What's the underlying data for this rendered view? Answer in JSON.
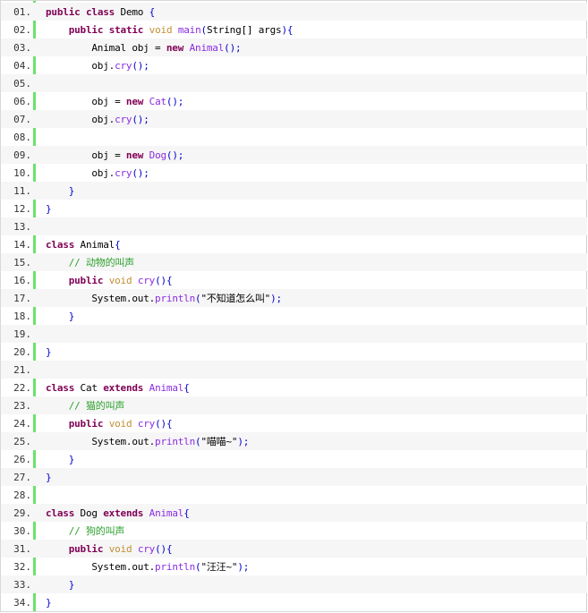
{
  "code_view": {
    "lines": [
      {
        "n": "01.",
        "tokens": [
          [
            "kw",
            "public"
          ],
          [
            "var",
            " "
          ],
          [
            "kw",
            "class"
          ],
          [
            "var",
            " Demo "
          ],
          [
            "punct",
            "{"
          ]
        ]
      },
      {
        "n": "02.",
        "tokens": [
          [
            "var",
            "    "
          ],
          [
            "kw",
            "public"
          ],
          [
            "var",
            " "
          ],
          [
            "kw",
            "static"
          ],
          [
            "var",
            " "
          ],
          [
            "type",
            "void"
          ],
          [
            "var",
            " "
          ],
          [
            "method",
            "main"
          ],
          [
            "punct",
            "("
          ],
          [
            "var",
            "String[] args"
          ],
          [
            "punct",
            ")"
          ],
          [
            "punct",
            "{"
          ]
        ]
      },
      {
        "n": "03.",
        "tokens": [
          [
            "var",
            "        Animal obj = "
          ],
          [
            "kw",
            "new"
          ],
          [
            "var",
            " "
          ],
          [
            "cls",
            "Animal"
          ],
          [
            "punct",
            "()"
          ],
          [
            "punct",
            ";"
          ]
        ]
      },
      {
        "n": "04.",
        "tokens": [
          [
            "var",
            "        obj."
          ],
          [
            "method",
            "cry"
          ],
          [
            "punct",
            "()"
          ],
          [
            "punct",
            ";"
          ]
        ]
      },
      {
        "n": "05.",
        "tokens": []
      },
      {
        "n": "06.",
        "tokens": [
          [
            "var",
            "        obj = "
          ],
          [
            "kw",
            "new"
          ],
          [
            "var",
            " "
          ],
          [
            "cls",
            "Cat"
          ],
          [
            "punct",
            "()"
          ],
          [
            "punct",
            ";"
          ]
        ]
      },
      {
        "n": "07.",
        "tokens": [
          [
            "var",
            "        obj."
          ],
          [
            "method",
            "cry"
          ],
          [
            "punct",
            "()"
          ],
          [
            "punct",
            ";"
          ]
        ]
      },
      {
        "n": "08.",
        "tokens": []
      },
      {
        "n": "09.",
        "tokens": [
          [
            "var",
            "        obj = "
          ],
          [
            "kw",
            "new"
          ],
          [
            "var",
            " "
          ],
          [
            "cls",
            "Dog"
          ],
          [
            "punct",
            "()"
          ],
          [
            "punct",
            ";"
          ]
        ]
      },
      {
        "n": "10.",
        "tokens": [
          [
            "var",
            "        obj."
          ],
          [
            "method",
            "cry"
          ],
          [
            "punct",
            "()"
          ],
          [
            "punct",
            ";"
          ]
        ]
      },
      {
        "n": "11.",
        "tokens": [
          [
            "var",
            "    "
          ],
          [
            "punct",
            "}"
          ]
        ]
      },
      {
        "n": "12.",
        "tokens": [
          [
            "punct",
            "}"
          ]
        ]
      },
      {
        "n": "13.",
        "tokens": []
      },
      {
        "n": "14.",
        "tokens": [
          [
            "kw",
            "class"
          ],
          [
            "var",
            " Animal"
          ],
          [
            "punct",
            "{"
          ]
        ]
      },
      {
        "n": "15.",
        "tokens": [
          [
            "var",
            "    "
          ],
          [
            "comment",
            "// 动物的叫声"
          ]
        ]
      },
      {
        "n": "16.",
        "tokens": [
          [
            "var",
            "    "
          ],
          [
            "kw",
            "public"
          ],
          [
            "var",
            " "
          ],
          [
            "type",
            "void"
          ],
          [
            "var",
            " "
          ],
          [
            "method",
            "cry"
          ],
          [
            "punct",
            "()"
          ],
          [
            "punct",
            "{"
          ]
        ]
      },
      {
        "n": "17.",
        "tokens": [
          [
            "var",
            "        System."
          ],
          [
            "var",
            "out."
          ],
          [
            "method",
            "println"
          ],
          [
            "punct",
            "("
          ],
          [
            "str",
            "\"不知道怎么叫\""
          ],
          [
            "punct",
            ")"
          ],
          [
            "punct",
            ";"
          ]
        ]
      },
      {
        "n": "18.",
        "tokens": [
          [
            "var",
            "    "
          ],
          [
            "punct",
            "}"
          ]
        ]
      },
      {
        "n": "19.",
        "tokens": []
      },
      {
        "n": "20.",
        "tokens": [
          [
            "punct",
            "}"
          ]
        ]
      },
      {
        "n": "21.",
        "tokens": []
      },
      {
        "n": "22.",
        "tokens": [
          [
            "kw",
            "class"
          ],
          [
            "var",
            " Cat "
          ],
          [
            "kw",
            "extends"
          ],
          [
            "var",
            " "
          ],
          [
            "cls",
            "Animal"
          ],
          [
            "punct",
            "{"
          ]
        ]
      },
      {
        "n": "23.",
        "tokens": [
          [
            "var",
            "    "
          ],
          [
            "comment",
            "// 猫的叫声"
          ]
        ]
      },
      {
        "n": "24.",
        "tokens": [
          [
            "var",
            "    "
          ],
          [
            "kw",
            "public"
          ],
          [
            "var",
            " "
          ],
          [
            "type",
            "void"
          ],
          [
            "var",
            " "
          ],
          [
            "method",
            "cry"
          ],
          [
            "punct",
            "()"
          ],
          [
            "punct",
            "{"
          ]
        ]
      },
      {
        "n": "25.",
        "tokens": [
          [
            "var",
            "        System."
          ],
          [
            "var",
            "out."
          ],
          [
            "method",
            "println"
          ],
          [
            "punct",
            "("
          ],
          [
            "str",
            "\"喵喵~\""
          ],
          [
            "punct",
            ")"
          ],
          [
            "punct",
            ";"
          ]
        ]
      },
      {
        "n": "26.",
        "tokens": [
          [
            "var",
            "    "
          ],
          [
            "punct",
            "}"
          ]
        ]
      },
      {
        "n": "27.",
        "tokens": [
          [
            "punct",
            "}"
          ]
        ]
      },
      {
        "n": "28.",
        "tokens": []
      },
      {
        "n": "29.",
        "tokens": [
          [
            "kw",
            "class"
          ],
          [
            "var",
            " Dog "
          ],
          [
            "kw",
            "extends"
          ],
          [
            "var",
            " "
          ],
          [
            "cls",
            "Animal"
          ],
          [
            "punct",
            "{"
          ]
        ]
      },
      {
        "n": "30.",
        "tokens": [
          [
            "var",
            "    "
          ],
          [
            "comment",
            "// 狗的叫声"
          ]
        ]
      },
      {
        "n": "31.",
        "tokens": [
          [
            "var",
            "    "
          ],
          [
            "kw",
            "public"
          ],
          [
            "var",
            " "
          ],
          [
            "type",
            "void"
          ],
          [
            "var",
            " "
          ],
          [
            "method",
            "cry"
          ],
          [
            "punct",
            "()"
          ],
          [
            "punct",
            "{"
          ]
        ]
      },
      {
        "n": "32.",
        "tokens": [
          [
            "var",
            "        System."
          ],
          [
            "var",
            "out."
          ],
          [
            "method",
            "println"
          ],
          [
            "punct",
            "("
          ],
          [
            "str",
            "\"汪汪~\""
          ],
          [
            "punct",
            ")"
          ],
          [
            "punct",
            ";"
          ]
        ]
      },
      {
        "n": "33.",
        "tokens": [
          [
            "var",
            "    "
          ],
          [
            "punct",
            "}"
          ]
        ]
      },
      {
        "n": "34.",
        "tokens": [
          [
            "punct",
            "}"
          ]
        ]
      }
    ]
  },
  "colors": {
    "gutter_bar": "#6ce26c",
    "keyword": "#7f0055",
    "type": "#c09030",
    "method": "#8a2be2",
    "comment": "#2ea02e",
    "punct": "#0000cc"
  }
}
